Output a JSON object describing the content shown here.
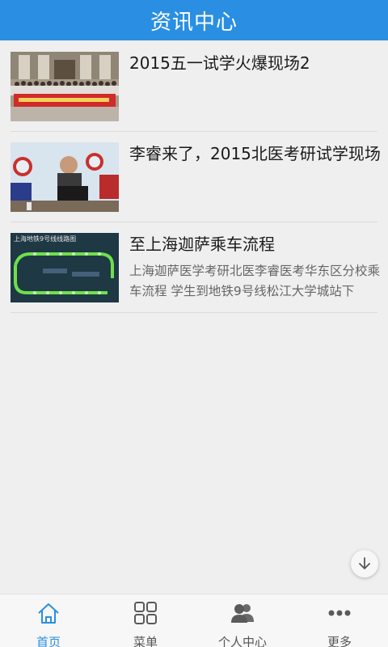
{
  "header": {
    "title": "资讯中心"
  },
  "news": [
    {
      "title": "2015五一试学火爆现场2",
      "desc": "",
      "thumb_icon": "group-photo-thumbnail"
    },
    {
      "title": "李睿来了，2015北医考研试学现场",
      "desc": "",
      "thumb_icon": "lecture-photo-thumbnail"
    },
    {
      "title": "至上海迦萨乘车流程",
      "desc": "上海迦萨医学考研北医李睿医考华东区分校乘车流程 学生到地铁9号线松江大学城站下",
      "thumb_icon": "metro-map-thumbnail",
      "thumb_caption": "上海地铁9号线线路图"
    }
  ],
  "tabbar": {
    "tabs": [
      {
        "label": "首页",
        "icon": "home-icon"
      },
      {
        "label": "菜单",
        "icon": "grid-icon"
      },
      {
        "label": "个人中心",
        "icon": "user-icon"
      },
      {
        "label": "更多",
        "icon": "more-icon"
      }
    ],
    "active_index": 0
  },
  "colors": {
    "accent": "#2a8fe2",
    "background": "#efeff0",
    "tab_inactive": "#555555"
  }
}
